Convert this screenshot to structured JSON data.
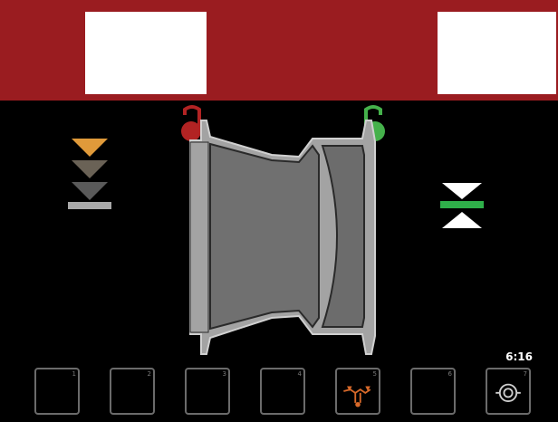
{
  "status": {
    "time": "6:16"
  },
  "toolbar": {
    "buttons": [
      {
        "number": "1",
        "icon": ""
      },
      {
        "number": "2",
        "icon": ""
      },
      {
        "number": "3",
        "icon": ""
      },
      {
        "number": "4",
        "icon": ""
      },
      {
        "number": "5",
        "icon": "balance-weight-icon"
      },
      {
        "number": "6",
        "icon": ""
      },
      {
        "number": "7",
        "icon": "wheel-clamp-icon"
      }
    ]
  },
  "indicators": {
    "left": {
      "icon": "position-down-arrows-icon",
      "colors": [
        "#e09a3a",
        "#6a6256",
        "#5a5a5a",
        "#a9a9a9"
      ]
    },
    "right": {
      "icon": "position-centered-icon",
      "colors": [
        "#ffffff",
        "#2fb04a"
      ]
    }
  },
  "wheel": {
    "left_weight_color": "#b22323",
    "right_weight_color": "#45b14b"
  },
  "colors": {
    "header": "#9a1c20",
    "background": "#000000"
  }
}
